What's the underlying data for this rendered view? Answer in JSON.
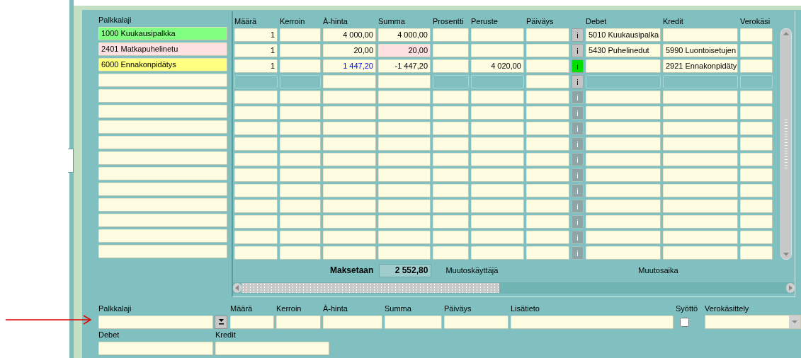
{
  "palkkalaji_label": "Palkkalaji",
  "grid": {
    "columns": [
      {
        "label": "Määrä"
      },
      {
        "label": "Kerroin"
      },
      {
        "label": "À-hinta"
      },
      {
        "label": "Summa"
      },
      {
        "label": "Prosentti"
      },
      {
        "label": "Peruste"
      },
      {
        "label": "Päiväys"
      },
      {
        "label": "Debet"
      },
      {
        "label": "Kredit"
      },
      {
        "label": "Verokäsi"
      }
    ],
    "rows": [
      {
        "kind": "data",
        "palkkalaji": "1000 Kuukausipalkka",
        "color": "#80ff80",
        "info": {
          "label": "i",
          "enabled": true,
          "highlighted": false
        },
        "cells": [
          {
            "text": "1",
            "disabled": false
          },
          {
            "disabled": false
          },
          {
            "text": "4 000,00",
            "disabled": false
          },
          {
            "text": "4 000,00",
            "disabled": false
          },
          {
            "disabled": false
          },
          {
            "disabled": false
          },
          {
            "disabled": false
          },
          {
            "text": "5010 Kuukausipalka",
            "disabled": false
          },
          {
            "disabled": false
          },
          {
            "disabled": false
          }
        ]
      },
      {
        "kind": "data",
        "palkkalaji": "2401 Matkapuhelinetu",
        "color": "#ffe0e0",
        "info": {
          "label": "i",
          "enabled": true,
          "highlighted": false
        },
        "cells": [
          {
            "text": "1",
            "disabled": false
          },
          {
            "disabled": false
          },
          {
            "text": "20,00",
            "disabled": false
          },
          {
            "text": "20,00",
            "disabled": false,
            "kind": "fill",
            "color": "#ffe0e0"
          },
          {
            "disabled": false
          },
          {
            "disabled": false
          },
          {
            "disabled": false
          },
          {
            "text": "5430 Puhelinedut",
            "disabled": false
          },
          {
            "text": "5990 Luontoisetujen",
            "disabled": false
          },
          {
            "disabled": false
          }
        ]
      },
      {
        "kind": "data",
        "palkkalaji": "6000 Ennakonpidätys",
        "color": "#ffff80",
        "info": {
          "label": "i",
          "enabled": true,
          "highlighted": true
        },
        "cells": [
          {
            "text": "1",
            "disabled": false
          },
          {
            "disabled": false
          },
          {
            "text": "1 447,20",
            "disabled": false,
            "kind": "ink",
            "color": "#0000ff"
          },
          {
            "text": "-1 447,20",
            "disabled": false
          },
          {
            "disabled": false
          },
          {
            "text": "4 020,00",
            "disabled": false
          },
          {
            "disabled": false
          },
          {
            "disabled": false
          },
          {
            "text": "2921 Ennakonpidäty",
            "disabled": false
          },
          {
            "disabled": false
          }
        ]
      },
      {
        "kind": "data",
        "info": {
          "label": "i",
          "enabled": true,
          "highlighted": false
        },
        "cells": [
          {
            "disabled": true
          },
          {
            "disabled": true
          },
          {
            "disabled": false
          },
          {
            "disabled": false
          },
          {
            "disabled": true
          },
          {
            "disabled": true
          },
          {
            "disabled": false
          },
          {
            "disabled": true
          },
          {
            "disabled": true
          },
          {
            "disabled": true
          }
        ]
      },
      {
        "kind": "blank",
        "info": {
          "label": "i",
          "enabled": false,
          "highlighted": false
        }
      },
      {
        "kind": "blank",
        "info": {
          "label": "i",
          "enabled": false,
          "highlighted": false
        }
      },
      {
        "kind": "blank",
        "info": {
          "label": "i",
          "enabled": false,
          "highlighted": false
        }
      },
      {
        "kind": "blank",
        "info": {
          "label": "i",
          "enabled": false,
          "highlighted": false
        }
      },
      {
        "kind": "blank",
        "info": {
          "label": "i",
          "enabled": false,
          "highlighted": false
        }
      },
      {
        "kind": "blank",
        "info": {
          "label": "i",
          "enabled": false,
          "highlighted": false
        }
      },
      {
        "kind": "blank",
        "info": {
          "label": "i",
          "enabled": false,
          "highlighted": false
        }
      },
      {
        "kind": "blank",
        "info": {
          "label": "i",
          "enabled": false,
          "highlighted": false
        }
      },
      {
        "kind": "blank",
        "info": {
          "label": "i",
          "enabled": false,
          "highlighted": false
        }
      },
      {
        "kind": "blank",
        "info": {
          "label": "i",
          "enabled": false,
          "highlighted": false
        }
      },
      {
        "kind": "blank",
        "info": {
          "label": "i",
          "enabled": false,
          "highlighted": false
        }
      }
    ],
    "footer": {
      "total_label": "Maksetaan",
      "total": "2 552,80",
      "user_label": "Muutoskäyttäjä",
      "time_label": "Muutosaika"
    }
  },
  "form": {
    "rows": [
      [
        {
          "label": "Palkkalaji",
          "kind": "lov"
        },
        {
          "label": "Määrä",
          "kind": "text"
        },
        {
          "label": "Kerroin",
          "kind": "text"
        },
        {
          "label": "À-hinta",
          "kind": "text"
        },
        {
          "label": "Summa",
          "kind": "text"
        },
        {
          "label": "Päiväys",
          "kind": "text"
        },
        {
          "label": "Lisätieto",
          "kind": "text"
        },
        {
          "label": "Syöttö",
          "kind": "checkbox",
          "checked": false
        },
        {
          "label": "Verokäsittely",
          "kind": "select"
        }
      ],
      [
        {
          "label": "Debet",
          "kind": "text"
        },
        {
          "label": "Kredit",
          "kind": "text"
        }
      ]
    ]
  }
}
